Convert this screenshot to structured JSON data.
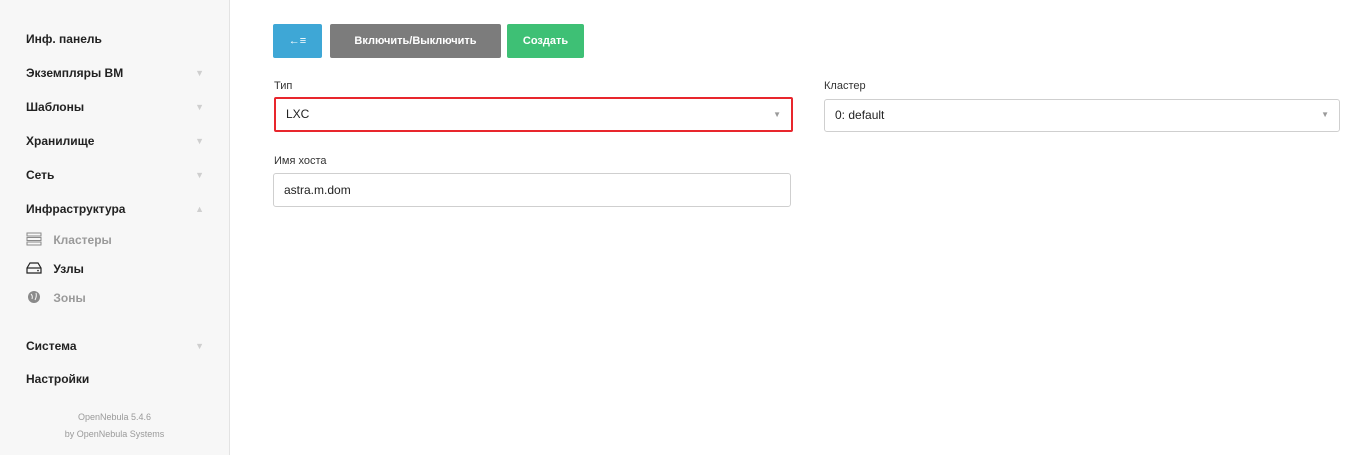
{
  "sidebar": {
    "items": [
      {
        "label": "Инф. панель"
      },
      {
        "label": "Экземпляры ВМ"
      },
      {
        "label": "Шаблоны"
      },
      {
        "label": "Хранилище"
      },
      {
        "label": "Сеть"
      },
      {
        "label": "Инфраструктура"
      },
      {
        "label": "Система"
      },
      {
        "label": "Настройки"
      }
    ],
    "sub_items": [
      {
        "label": "Кластеры"
      },
      {
        "label": "Узлы"
      },
      {
        "label": "Зоны"
      }
    ],
    "footer": {
      "version": "OpenNebula 5.4.6",
      "by": "by OpenNebula Systems"
    }
  },
  "toolbar": {
    "back_icon": "←≡",
    "toggle_label": "Включить/Выключить",
    "create_label": "Создать"
  },
  "form": {
    "type_label": "Тип",
    "type_value": "LXC",
    "cluster_label": "Кластер",
    "cluster_value": "0: default",
    "hostname_label": "Имя хоста",
    "hostname_value": "astra.m.dom"
  },
  "colors": {
    "accent_blue": "#3ea7d6",
    "gray_button": "#7c7c7c",
    "green_button": "#3ec075",
    "highlight_red": "#e8262d"
  }
}
